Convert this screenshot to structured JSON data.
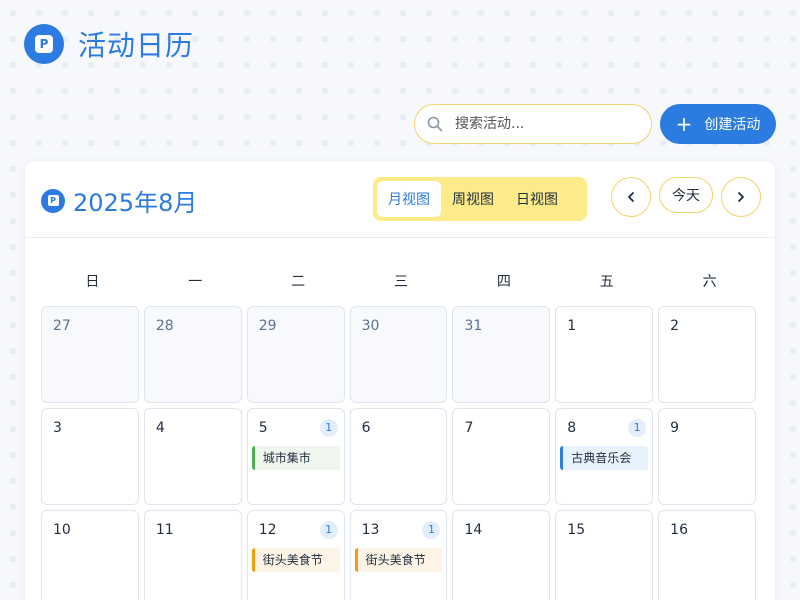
{
  "app": {
    "title": "活动日历",
    "logo_letter": "P"
  },
  "toolbar": {
    "search_placeholder": "搜索活动...",
    "create_label": "创建活动",
    "create_icon": "plus-icon"
  },
  "calendar": {
    "month_label": "2025年8月",
    "views": [
      {
        "label": "月视图",
        "active": true
      },
      {
        "label": "周视图",
        "active": false
      },
      {
        "label": "日视图",
        "active": false
      }
    ],
    "today_label": "今天",
    "prev_icon": "chevron-left-icon",
    "next_icon": "chevron-right-icon",
    "weekdays": [
      "日",
      "一",
      "二",
      "三",
      "四",
      "五",
      "六"
    ],
    "weeks": [
      [
        {
          "day": "27",
          "other": true
        },
        {
          "day": "28",
          "other": true
        },
        {
          "day": "29",
          "other": true
        },
        {
          "day": "30",
          "other": true
        },
        {
          "day": "31",
          "other": true
        },
        {
          "day": "1"
        },
        {
          "day": "2"
        }
      ],
      [
        {
          "day": "3"
        },
        {
          "day": "4"
        },
        {
          "day": "5",
          "count": "1",
          "event": {
            "label": "城市集市",
            "color": "green"
          }
        },
        {
          "day": "6"
        },
        {
          "day": "7"
        },
        {
          "day": "8",
          "count": "1",
          "event": {
            "label": "古典音乐会",
            "color": "blue"
          }
        },
        {
          "day": "9"
        }
      ],
      [
        {
          "day": "10"
        },
        {
          "day": "11"
        },
        {
          "day": "12",
          "count": "1",
          "event": {
            "label": "街头美食节",
            "color": "orange"
          }
        },
        {
          "day": "13",
          "count": "1",
          "event": {
            "label": "街头美食节",
            "color": "orange"
          }
        },
        {
          "day": "14"
        },
        {
          "day": "15"
        },
        {
          "day": "16"
        }
      ]
    ]
  },
  "colors": {
    "primary": "#2b7be0",
    "accent_border": "#f3d36b",
    "view_switch_bg": "#fdeb8a",
    "event_green": "#4caf50",
    "event_blue": "#2b7be0",
    "event_orange": "#f39c12"
  }
}
